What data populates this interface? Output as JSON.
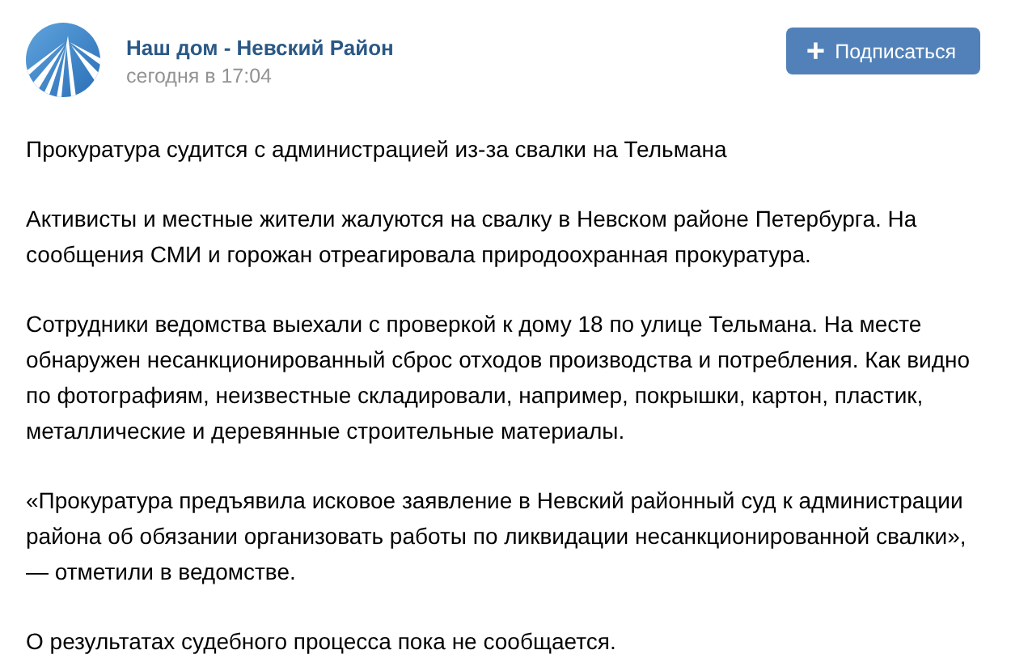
{
  "post": {
    "author": "Наш дом - Невский Район",
    "time": "сегодня в 17:04",
    "subscribe_button": {
      "icon": "+",
      "label": "Подписаться"
    },
    "paragraphs": [
      "Прокуратура судится с администрацией из-за свалки на Тельмана",
      "Активисты и местные жители жалуются на свалку в Невском районе Петербурга. На сообщения СМИ и горожан отреагировала природоохранная прокуратура.",
      "Сотрудники ведомства выехали с проверкой к дому 18 по улице Тельмана. На месте обнаружен несанкционированный сброс отходов производства и потребления. Как видно по фотографиям, неизвестные складировали, например, покрышки, картон, пластик, металлические и деревянные строительные материалы.",
      "«Прокуратура предъявила исковое заявление в Невский районный суд к администрации района об обязании организовать работы по ликвидации несанкционированной свалки», — отметили в ведомстве.",
      "О результатах судебного процесса пока не сообщается."
    ]
  }
}
